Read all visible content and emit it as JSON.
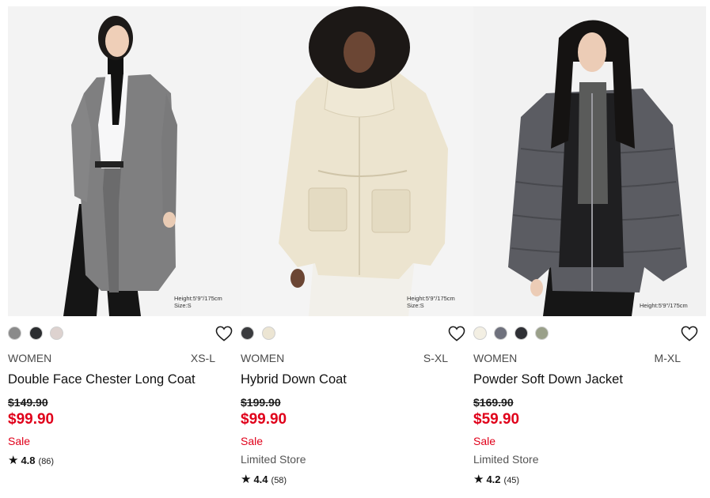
{
  "products": [
    {
      "photo_caption_lines": [
        "Height:5'9\"/175cm",
        "Size:S"
      ],
      "swatches": [
        "#8a8a8a",
        "#2b2d30",
        "#ddd2cf"
      ],
      "gender": "WOMEN",
      "size_range": "XS-L",
      "name": "Double Face Chester Long Coat",
      "original_price": "$149.90",
      "sale_price": "$99.90",
      "flag": "Sale",
      "store": "",
      "rating": "4.8",
      "review_count": "(86)"
    },
    {
      "photo_caption_lines": [
        "Height:5'9\"/175cm",
        "Size:S"
      ],
      "swatches": [
        "#3a3b3e",
        "#ece5d3"
      ],
      "gender": "WOMEN",
      "size_range": "S-XL",
      "name": "Hybrid Down Coat",
      "original_price": "$199.90",
      "sale_price": "$99.90",
      "flag": "Sale",
      "store": "Limited Store",
      "rating": "4.4",
      "review_count": "(58)"
    },
    {
      "photo_caption_lines": [
        "Height:5'9\"/175cm",
        ""
      ],
      "swatches": [
        "#f3efe3",
        "#6f717d",
        "#2f3035",
        "#9aa08a"
      ],
      "gender": "WOMEN",
      "size_range": "M-XL",
      "name": "Powder Soft Down Jacket",
      "original_price": "$169.90",
      "sale_price": "$59.90",
      "flag": "Sale",
      "store": "Limited Store",
      "rating": "4.2",
      "review_count": "(45)"
    }
  ],
  "icons": {
    "wishlist": "heart-outline-icon",
    "rating": "star-icon"
  },
  "colors": {
    "sale_red": "#e0001a",
    "text": "#1b1b1b"
  }
}
